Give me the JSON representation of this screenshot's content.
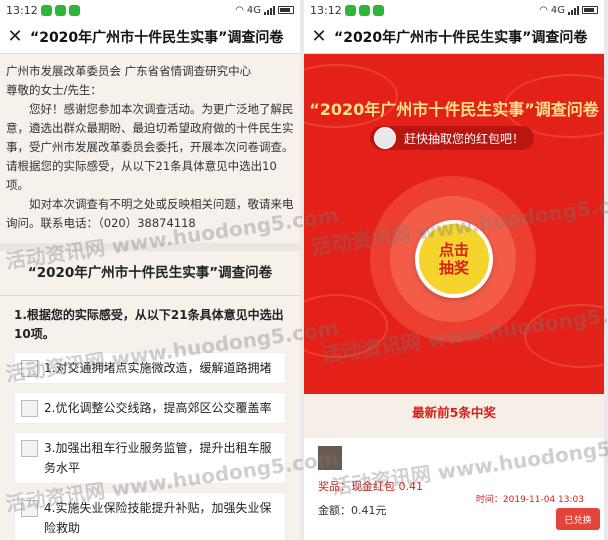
{
  "status": {
    "time": "13:12",
    "network": "4G"
  },
  "left": {
    "header_title": "“2020年广州市十件民生实事”调查问卷",
    "org_line": "广州市发展改革委员会   广东省省情调查研究中心",
    "greeting": "尊敬的女士/先生：",
    "para1": "您好！感谢您参加本次调查活动。为更广泛地了解民意，遴选出群众最期盼、最迫切希望政府做的十件民生实事，受广州市发展改革委员会委托，开展本次问卷调查。请根据您的实际感受，从以下21条具体意见中选出10项。",
    "para2": "如对本次调查有不明之处或反映相关问题，敬请来电询问。联系电话：（020）38874118",
    "survey_title": "“2020年广州市十件民生实事”调查问卷",
    "question": "1.根据您的实际感受，从以下21条具体意见中选出10项。",
    "options": [
      "1.对交通拥堵点实施微改造，缓解道路拥堵",
      "2.优化调整公交线路，提高郊区公交覆盖率",
      "3.加强出租车行业服务监管，提升出租车服务水平",
      "4.实施失业保险技能提升补贴，加强失业保险救助"
    ]
  },
  "right": {
    "header_title": "“2020年广州市十件民生实事”调查问卷",
    "banner_title": "“2020年广州市十件民生实事”调查问卷",
    "pill_text": "赶快抽取您的红包吧！",
    "draw_line1": "点击",
    "draw_line2": "抽奖",
    "winners_head": "最新前5条中奖",
    "winner_prize": "奖品：现金红包 0.41",
    "winner_amount": "金额：0.41元",
    "winner_time": "时间：2019-11-04 13:03",
    "winner_button": "已兑换"
  },
  "watermark": "活动资讯网 www.huodong5.com",
  "colors": {
    "red": "#e32119",
    "gold": "#f6d42e",
    "title_gold": "#ffe08a"
  }
}
